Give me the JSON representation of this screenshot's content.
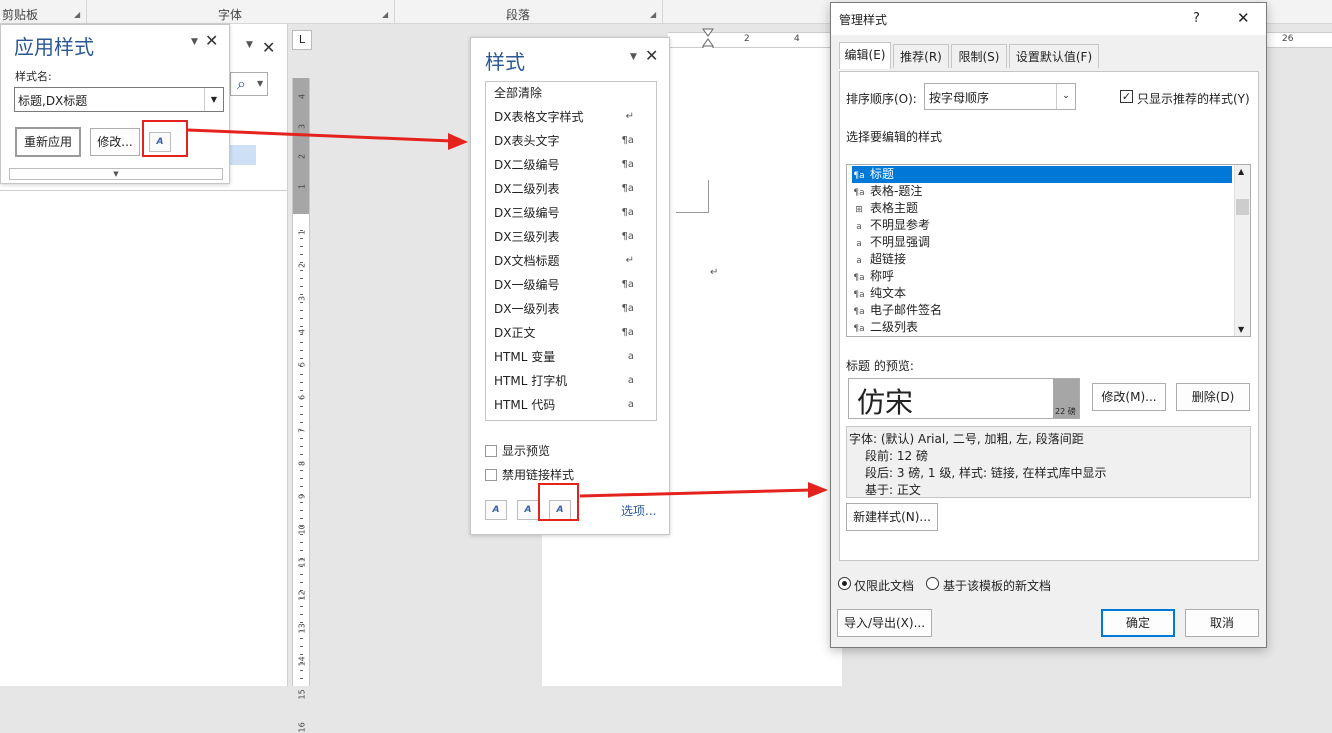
{
  "ribbon": {
    "groups": [
      "剪贴板",
      "字体",
      "段落"
    ]
  },
  "ruler": {
    "corner_glyph": "L",
    "h_numbers": [
      "2",
      "4",
      "26"
    ],
    "v_numbers": [
      "4",
      "3",
      "2",
      "1",
      "1",
      "2",
      "3",
      "4",
      "5",
      "6",
      "7",
      "8",
      "9",
      "10",
      "11",
      "12",
      "13",
      "14",
      "15",
      "16"
    ]
  },
  "apply_styles": {
    "title": "应用样式",
    "name_label": "样式名:",
    "style_value": "标题,DX标题",
    "reapply": "重新应用",
    "modify": "修改...",
    "search_glyph": "⌕"
  },
  "styles_pane": {
    "title": "样式",
    "items": [
      {
        "label": "全部清除",
        "symbol": ""
      },
      {
        "label": "DX表格文字样式",
        "symbol": "↵"
      },
      {
        "label": "DX表头文字",
        "symbol": "¶a"
      },
      {
        "label": "DX二级编号",
        "symbol": "¶a"
      },
      {
        "label": "DX二级列表",
        "symbol": "¶a"
      },
      {
        "label": "DX三级编号",
        "symbol": "¶a"
      },
      {
        "label": "DX三级列表",
        "symbol": "¶a"
      },
      {
        "label": "DX文档标题",
        "symbol": "↵"
      },
      {
        "label": "DX一级编号",
        "symbol": "¶a"
      },
      {
        "label": "DX一级列表",
        "symbol": "¶a"
      },
      {
        "label": "DX正文",
        "symbol": "¶a"
      },
      {
        "label": "HTML 变量",
        "symbol": "a"
      },
      {
        "label": "HTML 打字机",
        "symbol": "a"
      },
      {
        "label": "HTML 代码",
        "symbol": "a"
      }
    ],
    "show_preview": "显示预览",
    "disable_linked": "禁用链接样式",
    "options": "选项...",
    "new_style_glyph": "A",
    "inspector_glyph": "A",
    "manage_glyph": "A"
  },
  "manage_dialog": {
    "title": "管理样式",
    "help": "?",
    "close": "✕",
    "tabs": [
      "编辑(E)",
      "推荐(R)",
      "限制(S)",
      "设置默认值(F)"
    ],
    "sort_label": "排序顺序(O):",
    "sort_value": "按字母顺序",
    "only_recommended": "只显示推荐的样式(Y)",
    "select_label": "选择要编辑的样式",
    "list": [
      {
        "label": "标题",
        "glyph": "¶a",
        "selected": true
      },
      {
        "label": "表格-题注",
        "glyph": "¶a",
        "selected": false
      },
      {
        "label": "表格主题",
        "glyph": "⊞",
        "selected": false
      },
      {
        "label": "不明显参考",
        "glyph": "a",
        "selected": false
      },
      {
        "label": "不明显强调",
        "glyph": "a",
        "selected": false
      },
      {
        "label": "超链接",
        "glyph": "a",
        "selected": false
      },
      {
        "label": "称呼",
        "glyph": "¶a",
        "selected": false
      },
      {
        "label": "纯文本",
        "glyph": "¶a",
        "selected": false
      },
      {
        "label": "电子邮件签名",
        "glyph": "¶a",
        "selected": false
      },
      {
        "label": "二级列表",
        "glyph": "¶a",
        "selected": false
      }
    ],
    "preview_label": "标题 的预览:",
    "preview_text": "仿宋",
    "preview_size": "22 磅",
    "modify": "修改(M)...",
    "delete": "删除(D)",
    "desc": [
      "字体: (默认) Arial, 二号, 加粗, 左, 段落间距",
      "段前: 12 磅",
      "段后: 3 磅, 1 级, 样式: 链接, 在样式库中显示",
      "基于: 正文"
    ],
    "new_style": "新建样式(N)...",
    "radio_this_doc": "仅限此文档",
    "radio_template": "基于该模板的新文档",
    "import_export": "导入/导出(X)...",
    "ok": "确定",
    "cancel": "取消"
  },
  "colors": {
    "accent": "#2b5797",
    "highlight": "#e5231e",
    "selection": "#0078d7"
  }
}
